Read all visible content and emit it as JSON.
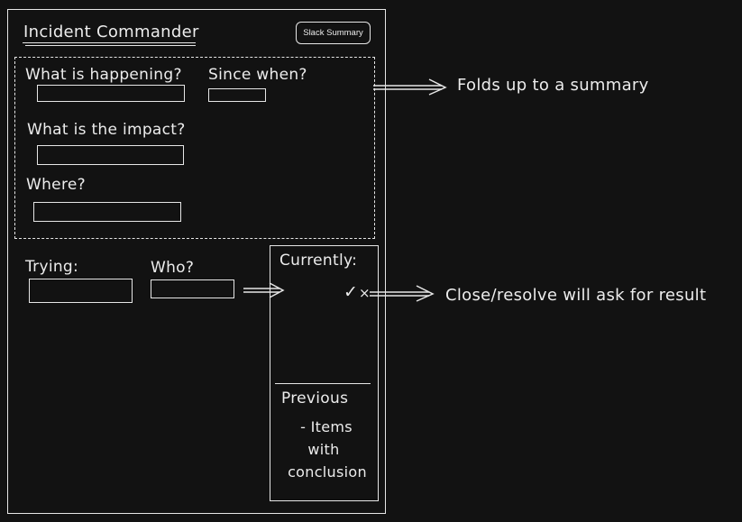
{
  "app": {
    "title": "Incident Commander",
    "summary_button": "Slack Summary"
  },
  "details": {
    "happening_label": "What is happening?",
    "since_label": "Since when?",
    "impact_label": "What is the impact?",
    "where_label": "Where?"
  },
  "actions": {
    "trying_label": "Trying:",
    "who_label": "Who?"
  },
  "current": {
    "label": "Currently:",
    "check_glyph": "✓",
    "close_glyph": "×"
  },
  "previous": {
    "label": "Previous",
    "lines": [
      "- Items",
      "with",
      "conclusion"
    ]
  },
  "annotations": {
    "fold_note": "Folds up to a summary",
    "resolve_note": "Close/resolve will ask for result"
  },
  "colors": {
    "background": "#121212",
    "stroke": "#e6e6e6",
    "text": "#ececec"
  }
}
